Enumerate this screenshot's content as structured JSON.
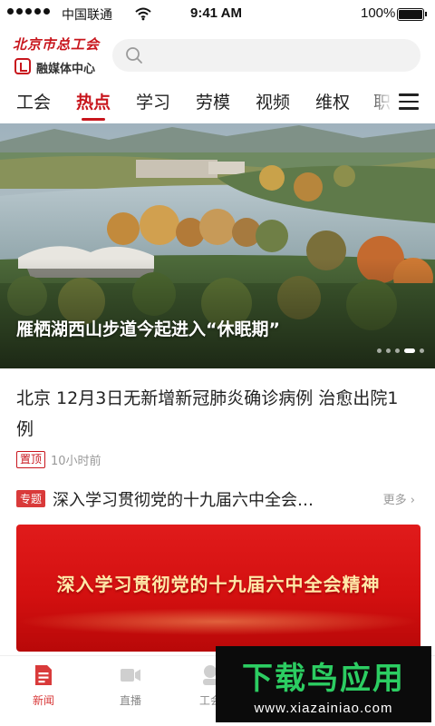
{
  "status_bar": {
    "carrier": "中国联通",
    "time": "9:41 AM",
    "battery": "100%"
  },
  "header": {
    "logo_title": "北京市总工会",
    "logo_subtitle": "融媒体中心",
    "search_placeholder": ""
  },
  "tabs": [
    {
      "label": "工会"
    },
    {
      "label": "热点",
      "active": true
    },
    {
      "label": "学习"
    },
    {
      "label": "劳模"
    },
    {
      "label": "视频"
    },
    {
      "label": "维权"
    },
    {
      "label": "职"
    }
  ],
  "banner": {
    "caption": "雁栖湖西山步道今起进入“休眠期”",
    "slide_count": 5,
    "current_slide": 4
  },
  "headline": {
    "title": "北京 12月3日无新增新冠肺炎确诊病例 治愈出院1例",
    "tag": "置顶",
    "time": "10小时前"
  },
  "topic": {
    "tag": "专题",
    "title": "深入学习贯彻党的十九届六中全会…",
    "more": "更多",
    "banner_text": "深入学习贯彻党的十九届六中全会精神"
  },
  "bottom_nav": [
    {
      "label": "新闻",
      "icon": "news-icon",
      "active": true
    },
    {
      "label": "直播",
      "icon": "live-video-icon"
    },
    {
      "label": "工会",
      "icon": "union-icon"
    }
  ],
  "watermark": {
    "title": "下载鸟应用",
    "url": "www.xiazainiao.com"
  },
  "colors": {
    "accent": "#c8161d",
    "topic_red": "#d93a3a",
    "watermark_green": "#2ccd62"
  }
}
